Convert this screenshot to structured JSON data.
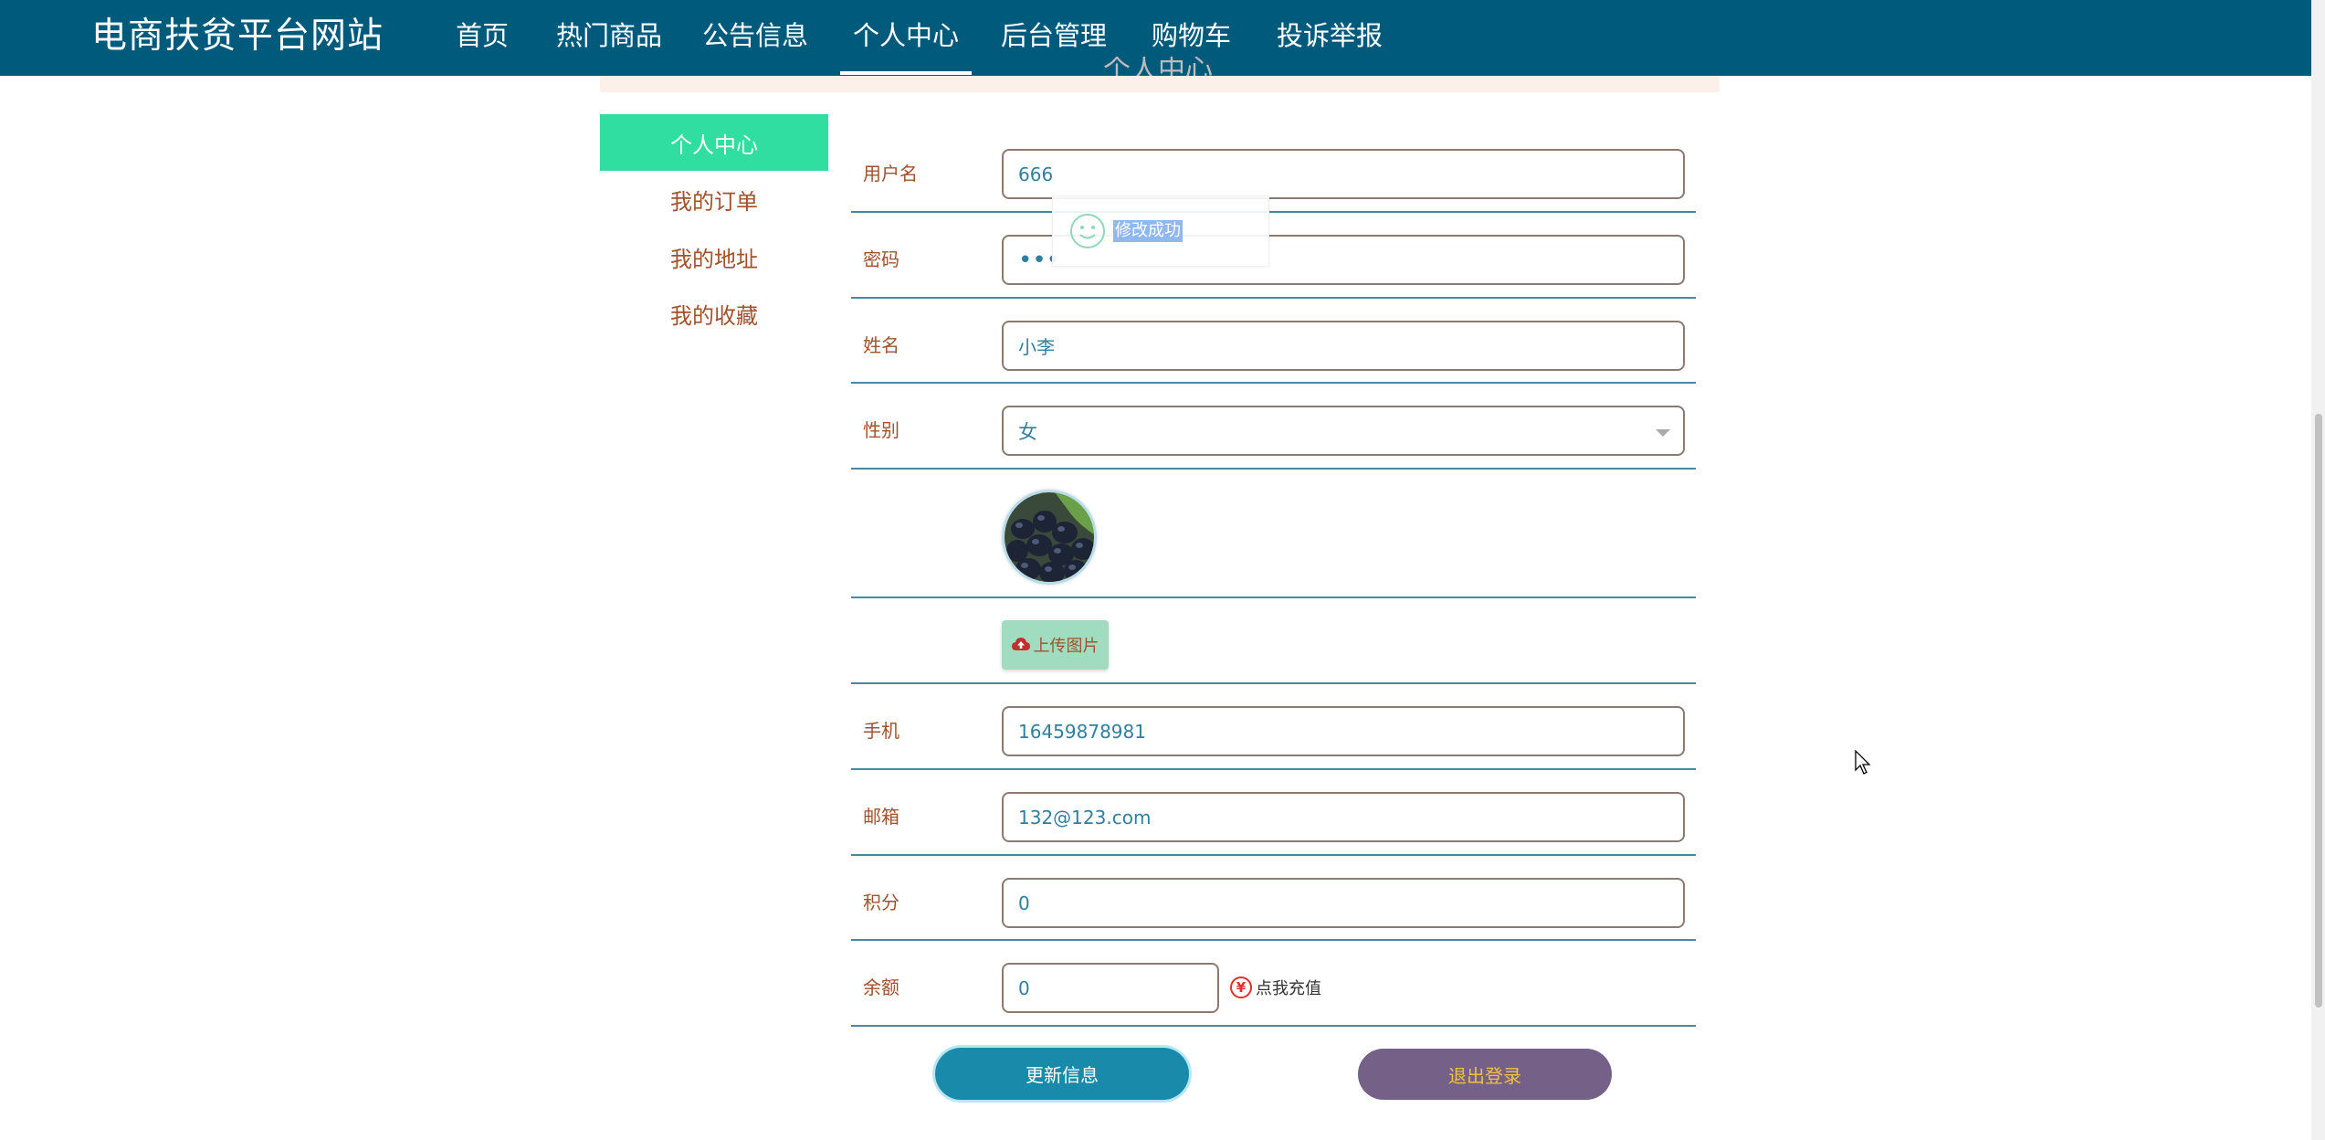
{
  "nav": {
    "site_title": "电商扶贫平台网站",
    "items": [
      "首页",
      "热门商品",
      "公告信息",
      "个人中心",
      "后台管理",
      "购物车",
      "投诉举报"
    ],
    "active_index": 3
  },
  "header": {
    "title": "个人中心"
  },
  "sidebar": {
    "items": [
      "个人中心",
      "我的订单",
      "我的地址",
      "我的收藏"
    ],
    "active_index": 0
  },
  "form": {
    "username_label": "用户名",
    "username_value": "666",
    "password_label": "密码",
    "password_value": "•••",
    "name_label": "姓名",
    "name_value": "小李",
    "gender_label": "性别",
    "gender_value": "女",
    "upload_label": "上传图片",
    "phone_label": "手机",
    "phone_value": "16459878981",
    "email_label": "邮箱",
    "email_value": "132@123.com",
    "points_label": "积分",
    "points_value": "0",
    "balance_label": "余额",
    "balance_value": "0",
    "recharge_label": "点我充值",
    "yen_symbol": "¥"
  },
  "buttons": {
    "update": "更新信息",
    "logout": "退出登录"
  },
  "toast": {
    "message": "修改成功",
    "icon": "smile-icon"
  },
  "colors": {
    "nav_bg": "#005a7c",
    "sidebar_active": "#2fdea0",
    "update_button": "#1a8aaa",
    "logout_button": "#756088"
  }
}
